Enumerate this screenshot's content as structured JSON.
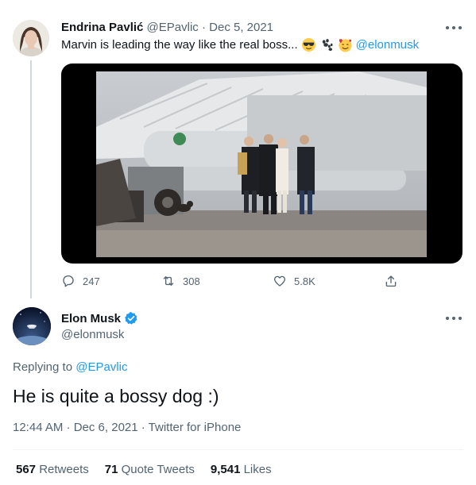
{
  "parent_tweet": {
    "name": "Endrina Pavlić",
    "handle": "@EPavlic",
    "separator": "·",
    "date": "Dec 5, 2021",
    "text": "Marvin is leading the way like the real boss...",
    "emojis": [
      "sunglasses-emoji",
      "paw-prints-emoji",
      "smiling-face-with-hearts-emoji"
    ],
    "mention": "@elonmusk",
    "media": {
      "type": "video",
      "description_icon": "video-thumbnail"
    },
    "actions": {
      "replies": "247",
      "retweets": "308",
      "likes": "5.8K"
    }
  },
  "main_tweet": {
    "name": "Elon Musk",
    "verified": true,
    "handle": "@elonmusk",
    "replying_prefix": "Replying to",
    "replying_to": "@EPavlic",
    "text": "He is quite a bossy dog :)",
    "meta": "12:44 AM · Dec 6, 2021 · Twitter for iPhone",
    "stats": {
      "retweets_count": "567",
      "retweets_label": "Retweets",
      "quotes_count": "71",
      "quotes_label": "Quote Tweets",
      "likes_count": "9,541",
      "likes_label": "Likes"
    }
  },
  "colors": {
    "accent": "#1d9bf0",
    "text": "#0f1419",
    "muted": "#536471",
    "divider": "#eff3f4"
  }
}
